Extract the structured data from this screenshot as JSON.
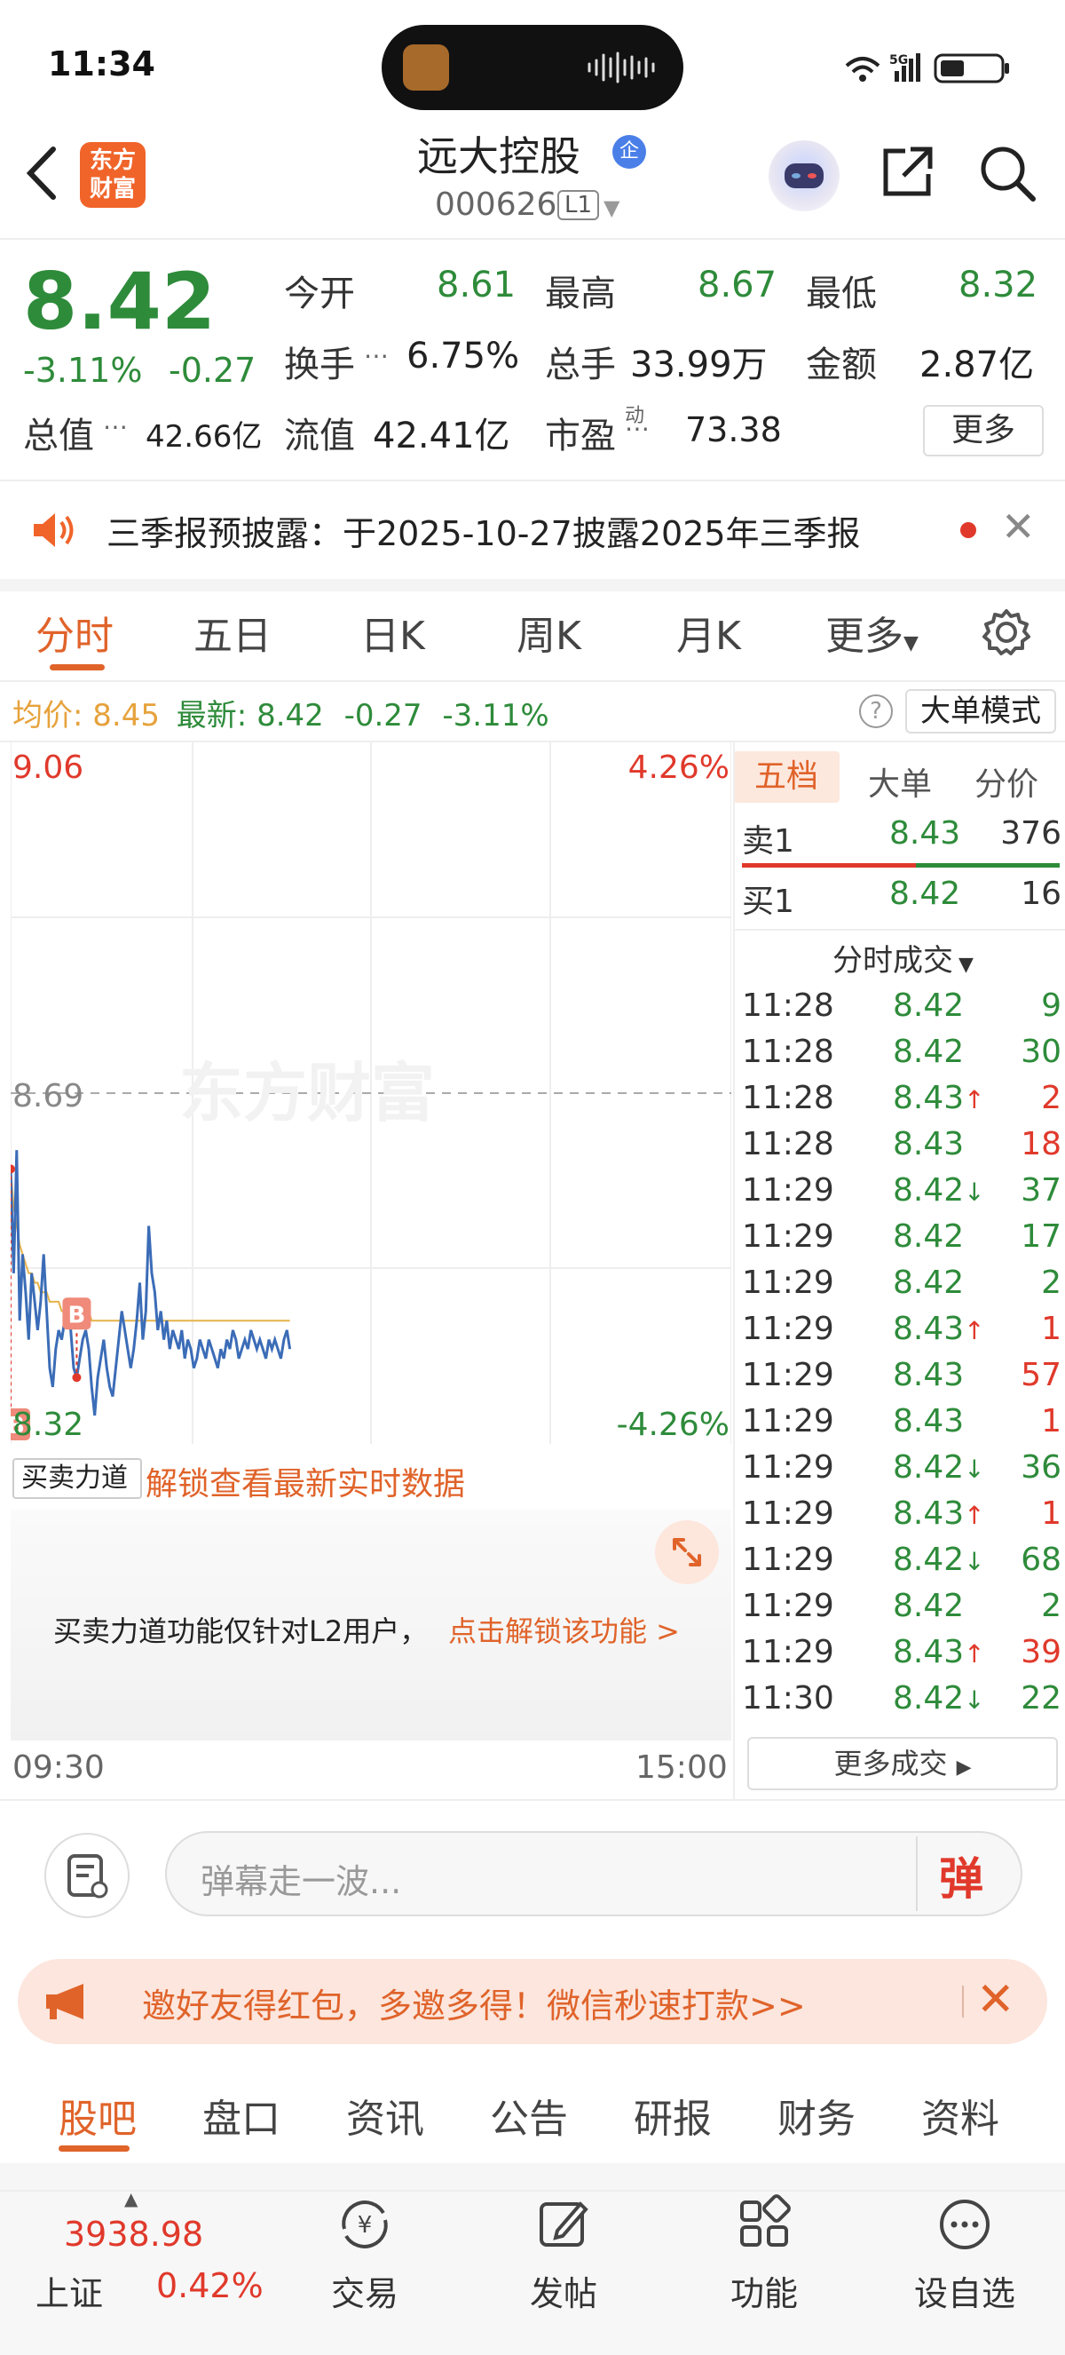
{
  "status_bar": {
    "time": "11:34",
    "network": "5G"
  },
  "nav": {
    "logo_line1": "东方",
    "logo_line2": "财富",
    "stock_name": "远大控股",
    "verified_badge": "企",
    "stock_code": "000626",
    "level": "L1"
  },
  "quote": {
    "price": "8.42",
    "pct_change": "-3.11%",
    "change": "-0.27",
    "open_label": "今开",
    "open": "8.61",
    "high_label": "最高",
    "high": "8.67",
    "low_label": "最低",
    "low": "8.32",
    "turnover_label": "换手",
    "turnover": "6.75%",
    "volume_label": "总手",
    "volume": "33.99万",
    "amount_label": "金额",
    "amount": "2.87亿",
    "mktcap_label": "总值",
    "mktcap": "42.66亿",
    "float_label": "流值",
    "float_cap": "42.41亿",
    "pe_label": "市盈",
    "pe_sup": "动",
    "pe": "73.38",
    "more_button": "更多"
  },
  "notice": {
    "text": "三季报预披露：于2025-10-27披露2025年三季报"
  },
  "chart_tabs": [
    "分时",
    "五日",
    "日K",
    "周K",
    "月K",
    "更多"
  ],
  "avg_bar": {
    "avg_label": "均价:",
    "avg": "8.45",
    "latest_label": "最新:",
    "latest": "8.42",
    "chg": "-0.27",
    "pct": "-3.11%",
    "big_order_mode": "大单模式"
  },
  "chart_data": {
    "type": "line",
    "y_top_label": "9.06",
    "y_top_pct": "4.26%",
    "y_mid_label": "8.69",
    "y_bottom_label": "8.32",
    "y_bottom_pct": "-4.26%",
    "ylim": [
      8.32,
      9.06
    ],
    "x_start": "09:30",
    "x_end": "15:00",
    "watermark": "东方财富",
    "markers": [
      "B",
      "B"
    ],
    "series": [
      {
        "name": "price",
        "color": "#3b6cb7",
        "values": [
          8.61,
          8.5,
          8.63,
          8.45,
          8.52,
          8.48,
          8.43,
          8.5,
          8.47,
          8.44,
          8.47,
          8.52,
          8.46,
          8.4,
          8.38,
          8.42,
          8.44,
          8.43,
          8.45,
          8.47,
          8.44,
          8.4,
          8.39,
          8.41,
          8.43,
          8.44,
          8.42,
          8.38,
          8.35,
          8.39,
          8.41,
          8.43,
          8.4,
          8.38,
          8.37,
          8.4,
          8.43,
          8.46,
          8.44,
          8.42,
          8.4,
          8.42,
          8.45,
          8.49,
          8.43,
          8.46,
          8.55,
          8.5,
          8.48,
          8.44,
          8.46,
          8.43,
          8.45,
          8.42,
          8.44,
          8.43,
          8.42,
          8.44,
          8.41,
          8.43,
          8.42,
          8.4,
          8.41,
          8.43,
          8.42,
          8.41,
          8.43,
          8.42,
          8.41,
          8.4,
          8.42,
          8.41,
          8.43,
          8.42,
          8.44,
          8.43,
          8.41,
          8.42,
          8.43,
          8.42,
          8.44,
          8.43,
          8.42,
          8.43,
          8.42,
          8.41,
          8.43,
          8.42,
          8.43,
          8.42,
          8.41,
          8.43,
          8.44,
          8.42
        ]
      },
      {
        "name": "avg",
        "color": "#e6b34a",
        "values": [
          8.61,
          8.57,
          8.55,
          8.53,
          8.52,
          8.51,
          8.5,
          8.5,
          8.49,
          8.49,
          8.48,
          8.48,
          8.48,
          8.47,
          8.47,
          8.47,
          8.47,
          8.46,
          8.46,
          8.46,
          8.46,
          8.46,
          8.46,
          8.46,
          8.46,
          8.46,
          8.46,
          8.45,
          8.45,
          8.45,
          8.45,
          8.45,
          8.45,
          8.45,
          8.45,
          8.45,
          8.45,
          8.45,
          8.45,
          8.45,
          8.45,
          8.45,
          8.45,
          8.45,
          8.45,
          8.45,
          8.45,
          8.45,
          8.45,
          8.45,
          8.45,
          8.45,
          8.45,
          8.45,
          8.45,
          8.45,
          8.45,
          8.45,
          8.45,
          8.45,
          8.45,
          8.45,
          8.45,
          8.45,
          8.45,
          8.45,
          8.45,
          8.45,
          8.45,
          8.45,
          8.45,
          8.45,
          8.45,
          8.45,
          8.45,
          8.45,
          8.45,
          8.45,
          8.45,
          8.45,
          8.45,
          8.45,
          8.45,
          8.45,
          8.45,
          8.45,
          8.45,
          8.45,
          8.45,
          8.45,
          8.45,
          8.45,
          8.45,
          8.45
        ]
      }
    ]
  },
  "right_panel": {
    "tabs": [
      "五档",
      "大单",
      "分价"
    ],
    "sell1_label": "卖1",
    "sell1_price": "8.43",
    "sell1_vol": "376",
    "buy1_label": "买1",
    "buy1_price": "8.42",
    "buy1_vol": "16",
    "trades_header": "分时成交",
    "trades": [
      {
        "t": "11:28",
        "p": "8.42",
        "d": "",
        "v": "9",
        "c": "green"
      },
      {
        "t": "11:28",
        "p": "8.42",
        "d": "",
        "v": "30",
        "c": "green"
      },
      {
        "t": "11:28",
        "p": "8.43",
        "d": "↑",
        "v": "2",
        "c": "red"
      },
      {
        "t": "11:28",
        "p": "8.43",
        "d": "",
        "v": "18",
        "c": "red"
      },
      {
        "t": "11:29",
        "p": "8.42",
        "d": "↓",
        "v": "37",
        "c": "green"
      },
      {
        "t": "11:29",
        "p": "8.42",
        "d": "",
        "v": "17",
        "c": "green"
      },
      {
        "t": "11:29",
        "p": "8.42",
        "d": "",
        "v": "2",
        "c": "green"
      },
      {
        "t": "11:29",
        "p": "8.43",
        "d": "↑",
        "v": "1",
        "c": "red"
      },
      {
        "t": "11:29",
        "p": "8.43",
        "d": "",
        "v": "57",
        "c": "red"
      },
      {
        "t": "11:29",
        "p": "8.43",
        "d": "",
        "v": "1",
        "c": "red"
      },
      {
        "t": "11:29",
        "p": "8.42",
        "d": "↓",
        "v": "36",
        "c": "green"
      },
      {
        "t": "11:29",
        "p": "8.43",
        "d": "↑",
        "v": "1",
        "c": "red"
      },
      {
        "t": "11:29",
        "p": "8.42",
        "d": "↓",
        "v": "68",
        "c": "green"
      },
      {
        "t": "11:29",
        "p": "8.42",
        "d": "",
        "v": "2",
        "c": "green"
      },
      {
        "t": "11:29",
        "p": "8.43",
        "d": "↑",
        "v": "39",
        "c": "red"
      },
      {
        "t": "11:30",
        "p": "8.42",
        "d": "↓",
        "v": "22",
        "c": "green"
      }
    ],
    "more_trades": "更多成交"
  },
  "sub_chart": {
    "force_label": "买卖力道",
    "unlock_text": "解锁查看最新实时数据",
    "msg": "买卖力道功能仅针对L2用户，",
    "link": "点击解锁该功能 >"
  },
  "comment": {
    "placeholder": "弹幕走一波...",
    "button": "弹"
  },
  "invite": {
    "text": "邀好友得红包，多邀多得！微信秒速打款>>"
  },
  "bottom_tabs": [
    "股吧",
    "盘口",
    "资讯",
    "公告",
    "研报",
    "财务",
    "资料"
  ],
  "bottom_nav": {
    "index_value": "3938.98",
    "index_name": "上证",
    "index_pct": "0.42%",
    "items": [
      "交易",
      "发帖",
      "功能",
      "设自选"
    ]
  }
}
